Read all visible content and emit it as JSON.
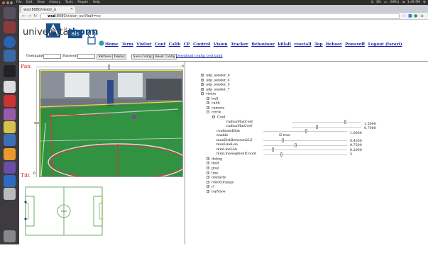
{
  "system_bar": {
    "menus": [
      "File",
      "Edit",
      "View",
      "History",
      "Tools",
      "People",
      "Help"
    ],
    "clock": "1:49 PM",
    "battery": "(99%)",
    "lang": "EN"
  },
  "browser": {
    "tab_title": "wsd:8080/vision_o",
    "url_host": "wsd",
    "url_rest": ":8080/vision_out?ball=no"
  },
  "page": {
    "logo_text_pre": "universität",
    "logo_text_bold": "bonn",
    "logo_badge": "ais",
    "nav_links": [
      "Home",
      "Term",
      "VisOut",
      "Conf",
      "Calib",
      "CP",
      "Control",
      "Vision",
      "Tracker",
      "Behaviour",
      "killall",
      "resetall",
      "Top",
      "Reboot",
      "Poweroff",
      "Logout (farazi)"
    ],
    "username_label": "Username:",
    "password_label": "Password:",
    "username_value": "",
    "password_value": "",
    "buttons": [
      "Retrieve",
      "Deploy",
      "Save Config",
      "Reset Config"
    ],
    "download_link": "Download config_tool.yaml"
  },
  "camera": {
    "pan_label": "Pan",
    "pan_value": "0",
    "tilt_label": "Tilt",
    "tilt_value": "0",
    "pan_level": 0.5,
    "tilt_level": 0.5
  },
  "tree": [
    {
      "sign": "+",
      "label": "udp_sender_0",
      "indent": 0
    },
    {
      "sign": "+",
      "label": "udp_sender_4",
      "indent": 0
    },
    {
      "sign": "+",
      "label": "udp_sender_5",
      "indent": 0
    },
    {
      "sign": "+",
      "label": "udp_sender_7",
      "indent": 0
    },
    {
      "sign": "−",
      "label": "vision",
      "indent": 0
    },
    {
      "sign": "+",
      "label": "ball",
      "indent": 1
    },
    {
      "sign": "+",
      "label": "calib",
      "indent": 1
    },
    {
      "sign": "+",
      "label": "camera",
      "indent": 1
    },
    {
      "sign": "−",
      "label": "circle",
      "indent": 1
    },
    {
      "sign": "−",
      "label": "Coef",
      "indent": 2
    }
  ],
  "params": [
    {
      "label": "radiusMaxCoef",
      "value": "1.5000",
      "level": 0.75
    },
    {
      "label": "radiusMinCoef",
      "value": "0.7000",
      "level": 0.35
    },
    {
      "label": "confiusedDist",
      "value": "1.0000",
      "level": 0.5
    },
    {
      "label": "enable",
      "value": "true",
      "checkbox": true
    },
    {
      "label": "maxDistBetween2LS",
      "value": "0.4300",
      "level": 0.22
    },
    {
      "label": "maxLineLen",
      "value": "0.7500",
      "level": 0.37
    },
    {
      "label": "minLineLen",
      "value": "0.2000",
      "level": 0.1
    },
    {
      "label": "minLineSegmentCount",
      "value": "2",
      "level": 0.2
    }
  ],
  "tree_tail": [
    {
      "sign": "+",
      "label": "debug"
    },
    {
      "sign": "+",
      "label": "field"
    },
    {
      "sign": "+",
      "label": "goal"
    },
    {
      "sign": "+",
      "label": "line"
    },
    {
      "sign": "+",
      "label": "obstacle"
    },
    {
      "sign": "+",
      "label": "robotOrange"
    },
    {
      "sign": "+",
      "label": "rl"
    },
    {
      "sign": "+",
      "label": "topView"
    }
  ]
}
